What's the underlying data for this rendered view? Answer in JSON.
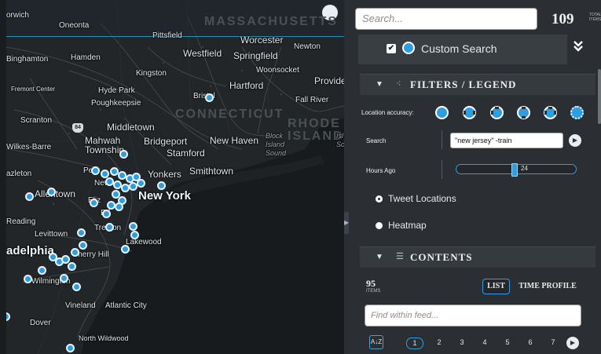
{
  "map": {
    "places": [
      {
        "name": "orwich"
      },
      {
        "name": "Oneonta"
      },
      {
        "name": "Pittsfield"
      },
      {
        "name": "Worcester"
      },
      {
        "name": "Newton"
      },
      {
        "name": "Westfield"
      },
      {
        "name": "Springfield"
      },
      {
        "name": "Binghamton"
      },
      {
        "name": "Hamden"
      },
      {
        "name": "Kingston"
      },
      {
        "name": "Woonsocket"
      },
      {
        "name": "Provide"
      },
      {
        "name": "Hartford"
      },
      {
        "name": "Fremont Center"
      },
      {
        "name": "Hyde Park"
      },
      {
        "name": "Poughkeepsie"
      },
      {
        "name": "Bristol"
      },
      {
        "name": "Fall River"
      },
      {
        "name": "Scranton"
      },
      {
        "name": "Middletown"
      },
      {
        "name": "Mahwah Township"
      },
      {
        "name": "Bridgeport"
      },
      {
        "name": "New Haven"
      },
      {
        "name": "Wilkes-Barre"
      },
      {
        "name": "Stamford"
      },
      {
        "name": "Yonkers"
      },
      {
        "name": "Smithtown"
      },
      {
        "name": "azleton"
      },
      {
        "name": "Newa"
      },
      {
        "name": "New York"
      },
      {
        "name": "Allentown"
      },
      {
        "name": "Eliz"
      },
      {
        "name": "Reading"
      },
      {
        "name": "Ed"
      },
      {
        "name": "Trenton"
      },
      {
        "name": "Lakewood"
      },
      {
        "name": "Levittown"
      },
      {
        "name": "adelphia"
      },
      {
        "name": "Cherry Hill"
      },
      {
        "name": "Wilmington"
      },
      {
        "name": "Vineland"
      },
      {
        "name": "Atlantic City"
      },
      {
        "name": "Dover"
      },
      {
        "name": "North Wildwood"
      },
      {
        "name": "Pe"
      }
    ],
    "states": [
      "MASSACHUSETTS",
      "CONNECTICUT",
      "RHODE ISLAND"
    ],
    "water": [
      "Block Island Sound",
      "Isl Sou"
    ],
    "highway_shield": "84"
  },
  "header": {
    "search_placeholder": "Search...",
    "total_count": "109",
    "total_label": "TOTAL ITEMS"
  },
  "custom_search": {
    "checkbox_mark": "✔",
    "label": "Custom Search",
    "collapse_icon": "double-chevron-down-icon"
  },
  "filters": {
    "title": "FILTERS / LEGEND",
    "location_accuracy_label": "Location accuracy:",
    "search_label": "Search",
    "search_value": "\"new jersey\" -train",
    "hours_label": "Hours Ago",
    "hours_value": "24",
    "hours_fraction": 0.47,
    "options": [
      {
        "label": "Tweet Locations",
        "selected": true
      },
      {
        "label": "Heatmap",
        "selected": false
      }
    ]
  },
  "contents": {
    "title": "CONTENTS",
    "item_count": "95",
    "item_label": "ITEMS",
    "tabs": [
      {
        "label": "LIST",
        "active": true
      },
      {
        "label": "TIME PROFILE",
        "active": false
      }
    ],
    "feed_placeholder": "Find within feed...",
    "sort_icon": "A↓Z",
    "pages": [
      "1",
      "2",
      "3",
      "4",
      "5",
      "6",
      "7"
    ],
    "current_page": "1"
  },
  "colors": {
    "accent": "#2e9ee0",
    "panel": "#2b2f33",
    "map": "#171b1d"
  }
}
